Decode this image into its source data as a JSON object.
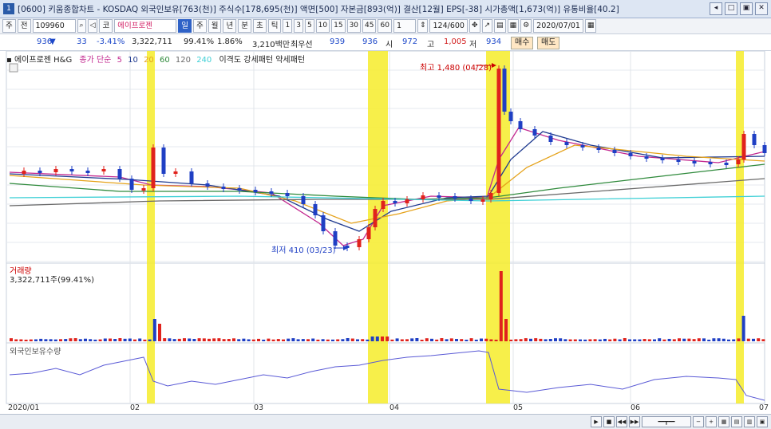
{
  "titlebar": {
    "icon": "1",
    "text": "[0600] 키움종합차트 - KOSDAQ 외국인보유[763(천)] 주식수[178,695(천)] 액면[500] 자본금[893(억)] 결산[12월] EPS[-38] 시가총액[1,673(억)] 유통비율[40.2]",
    "buttons": [
      "◂",
      "□",
      "▣",
      "✕"
    ]
  },
  "toolbar": {
    "period": "주",
    "view": "전",
    "code": "109960",
    "market_button": "코",
    "stock_name": "에이프로젠",
    "period_buttons": [
      "일",
      "주",
      "월",
      "년",
      "분",
      "초",
      "틱"
    ],
    "interval_buttons": [
      "1",
      "3",
      "5",
      "10",
      "15",
      "30",
      "45",
      "60"
    ],
    "count_input": "1",
    "range": "124/600",
    "date": "2020/07/01"
  },
  "quote": {
    "price": "936",
    "change_arrow": "▼",
    "change": "33",
    "change_pct": "-3.41%",
    "volume": "3,322,711",
    "volume_pct": "99.41%",
    "ratio": "1.86%",
    "amount": "3,210백만",
    "best_ask_label": "최우선",
    "best_ask": "939",
    "best_bid": "936",
    "open_label": "시",
    "open": "972",
    "high_label": "고",
    "high": "1,005",
    "low_label": "저",
    "low": "934",
    "buy_button": "매수",
    "sell_button": "매도"
  },
  "legend": {
    "name": "에이프로젠 H&G",
    "ma_label": "종가 단순",
    "ma_periods": [
      "5",
      "10",
      "20",
      "60",
      "120",
      "240"
    ],
    "pattern_text": "이격도 강세패턴  약세패턴"
  },
  "annotations": {
    "high": "최고 1,480 (04/28)",
    "low": "최저 410 (03/23)"
  },
  "volume_panel": {
    "title": "거래량",
    "value": "3,322,711주(99.41%)"
  },
  "foreign_panel": {
    "title": "외국인보유수량"
  },
  "xaxis": {
    "labels": [
      "2020/01",
      "02",
      "03",
      "04",
      "05",
      "06",
      "07"
    ]
  },
  "colors": {
    "up": "#e0221c",
    "down": "#1f3fc4",
    "highlight": "#f6ec2a",
    "ma5": "#c2288f",
    "ma10": "#1f3a8f",
    "ma20": "#e5a21a",
    "ma60": "#2f8a3c",
    "ma120": "#6a6a6a",
    "ma240": "#3fd0d6"
  }
}
